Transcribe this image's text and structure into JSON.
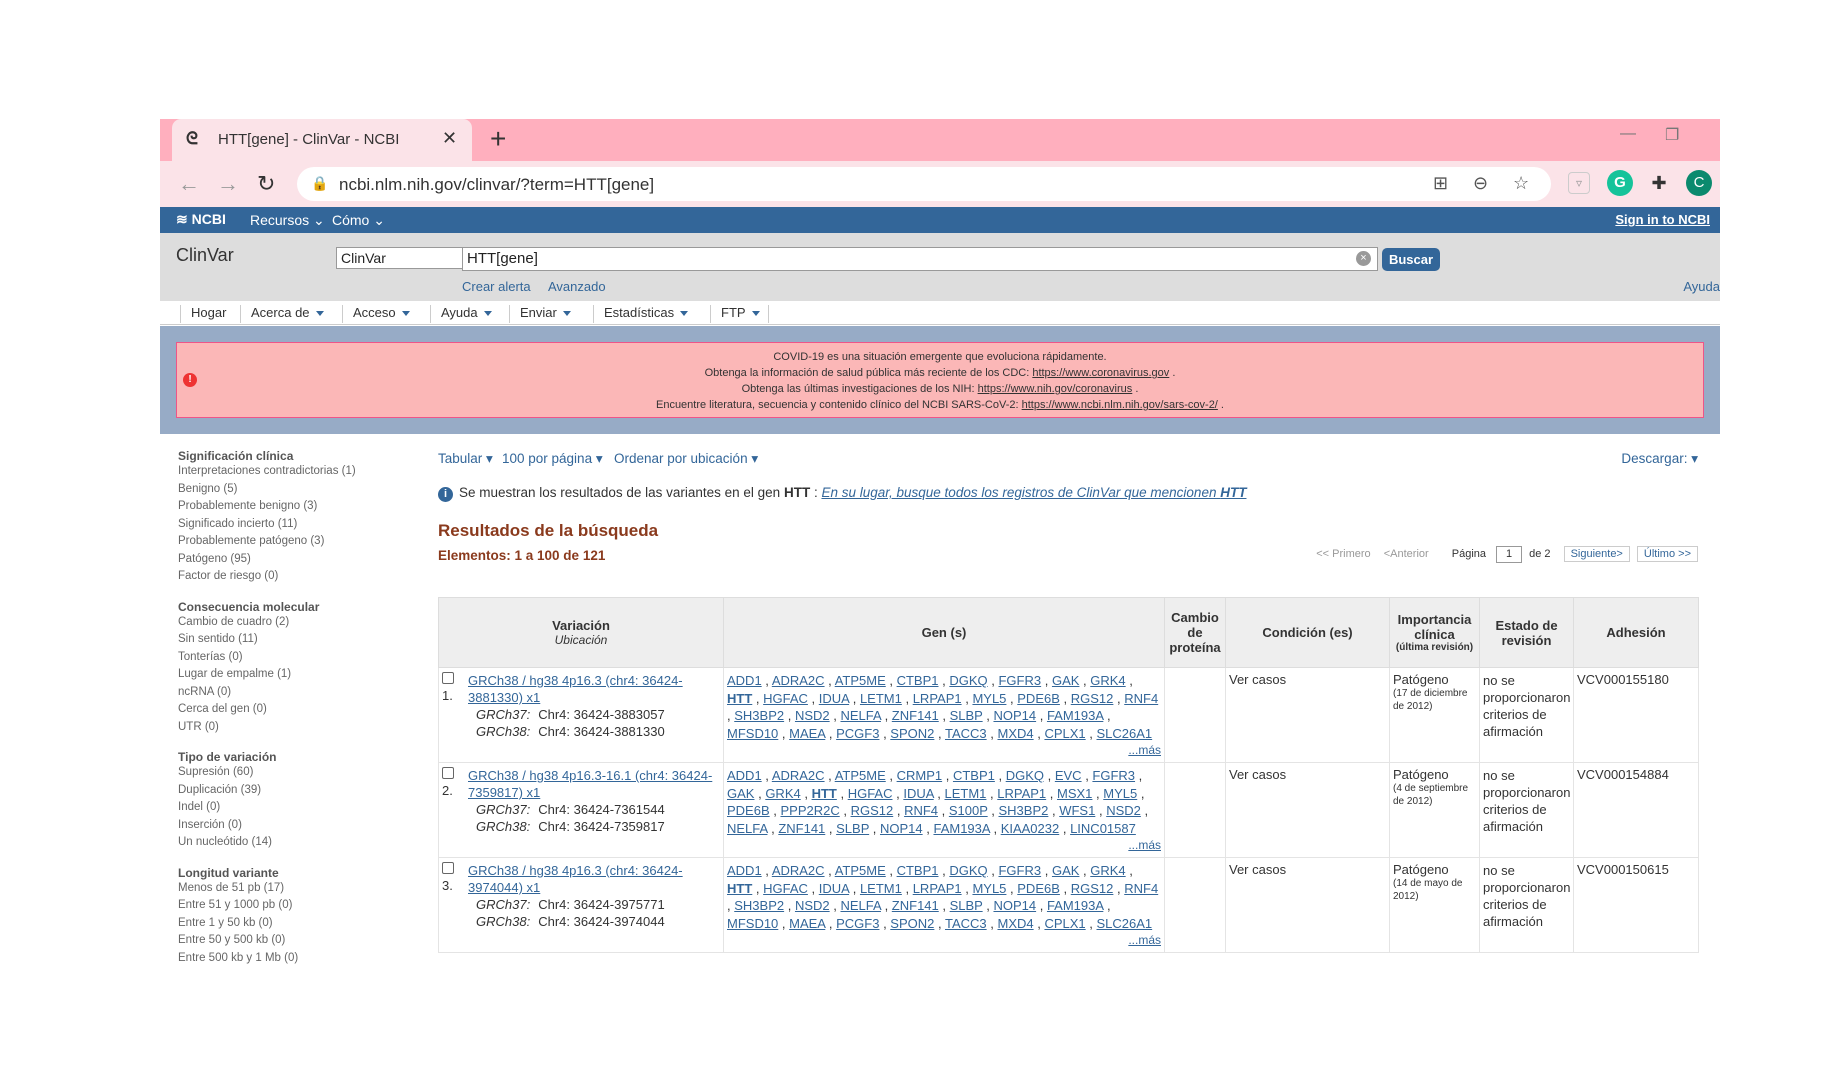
{
  "browser": {
    "tab_title": "HTT[gene] - ClinVar - NCBI",
    "url": "ncbi.nlm.nih.gov/clinvar/?term=HTT[gene]",
    "profile_initial": "C",
    "grammarly_initial": "G"
  },
  "ncbi": {
    "logo": "NCBI",
    "nav_recursos": "Recursos",
    "nav_como": "Cómo",
    "signin": "Sign in to NCBI"
  },
  "search": {
    "db_name": "ClinVar",
    "db_select": "ClinVar",
    "term": "HTT[gene]",
    "button": "Buscar",
    "crear_alerta": "Crear alerta",
    "avanzado": "Avanzado",
    "ayuda": "Ayuda"
  },
  "menu": {
    "items": [
      "Hogar",
      "Acerca de",
      "Acceso",
      "Ayuda",
      "Enviar",
      "Estadísticas",
      "FTP"
    ]
  },
  "banner": {
    "line1": "COVID-19 es una situación emergente que evoluciona rápidamente.",
    "line2_text": "Obtenga la información de salud pública más reciente de los CDC:",
    "line2_link": "https://www.coronavirus.gov",
    "line3_text": "Obtenga las últimas investigaciones de los NIH:",
    "line3_link": "https://www.nih.gov/coronavirus",
    "line4_text": "Encuentre literatura, secuencia y contenido clínico del NCBI SARS-CoV-2:",
    "line4_link": "https://www.ncbi.nlm.nih.gov/sars-cov-2/"
  },
  "facets": [
    {
      "title": "Significación clínica",
      "items": [
        "Interpretaciones contradictorias  (1)",
        "Benigno  (5)",
        "Probablemente benigno  (3)",
        "Significado incierto  (11)",
        "Probablemente patógeno  (3)",
        "Patógeno  (95)",
        "Factor de riesgo  (0)"
      ]
    },
    {
      "title": "Consecuencia molecular",
      "items": [
        "Cambio de cuadro  (2)",
        "Sin sentido  (11)",
        "Tonterías  (0)",
        "Lugar de empalme  (1)",
        "ncRNA  (0)",
        "Cerca del gen  (0)",
        "UTR  (0)"
      ]
    },
    {
      "title": "Tipo de variación",
      "items": [
        "Supresión  (60)",
        "Duplicación  (39)",
        "Indel  (0)",
        "Inserción  (0)",
        "Un nucleótido  (14)"
      ]
    },
    {
      "title": "Longitud variante",
      "items": [
        "Menos de 51 pb  (17)",
        "Entre 51 y 1000 pb  (0)",
        "Entre 1 y 50 kb  (0)",
        "Entre 50 y 500 kb  (0)",
        "Entre 500 kb y 1 Mb  (0)"
      ]
    }
  ],
  "controls": {
    "tabular": "Tabular",
    "per_page": "100 por página",
    "sort": "Ordenar por ubicación",
    "download": "Descargar:"
  },
  "info": {
    "text": "Se muestran los resultados de las variantes en el gen",
    "gene": "HTT",
    "link_text": "En su lugar, busque todos los registros de ClinVar que mencionen",
    "link_gene": "HTT"
  },
  "results": {
    "title": "Resultados de la búsqueda",
    "elements": "Elementos: 1 a 100 de 121"
  },
  "pager": {
    "first": "<< Primero",
    "prev": "<Anterior",
    "page_label": "Página",
    "page_value": "1",
    "of": "de 2",
    "next": "Siguiente>",
    "last": "Último >>"
  },
  "table": {
    "headers": {
      "variation": "Variación",
      "location": "Ubicación",
      "genes": "Gen (s)",
      "protein": "Cambio de proteína",
      "condition": "Condición (es)",
      "importance": "Importancia clínica",
      "importance_sub": "(última revisión)",
      "review": "Estado de revisión",
      "accession": "Adhesión"
    },
    "rows": [
      {
        "num": "1.",
        "variant": "GRCh38 / hg38 4p16.3 (chr4: 36424-3881330) x1",
        "grch37_label": "GRCh37:",
        "grch37": "Chr4: 36424-3883057",
        "grch38_label": "GRCh38:",
        "grch38": "Chr4: 36424-3881330",
        "genes": [
          "ADD1",
          "ADRA2C",
          "ATP5ME",
          "CTBP1",
          "DGKQ",
          "FGFR3",
          "GAK",
          "GRK4",
          "HTT",
          "HGFAC",
          "IDUA",
          "LETM1",
          "LRPAP1",
          "MYL5",
          "PDE6B",
          "RGS12",
          "RNF4",
          "SH3BP2",
          "NSD2",
          "NELFA",
          "ZNF141",
          "SLBP",
          "NOP14",
          "FAM193A",
          "MFSD10",
          "MAEA",
          "PCGF3",
          "SPON2",
          "TACC3",
          "MXD4",
          "CPLX1",
          "SLC26A1"
        ],
        "mas": "...más",
        "condition": "Ver casos",
        "significance": "Patógeno",
        "sig_date": "(17 de diciembre de 2012)",
        "review": "no se proporcionaron criterios de afirmación",
        "accession": "VCV000155180"
      },
      {
        "num": "2.",
        "variant": "GRCh38 / hg38 4p16.3-16.1 (chr4: 36424-7359817) x1",
        "grch37_label": "GRCh37:",
        "grch37": "Chr4: 36424-7361544",
        "grch38_label": "GRCh38:",
        "grch38": "Chr4: 36424-7359817",
        "genes": [
          "ADD1",
          "ADRA2C",
          "ATP5ME",
          "CRMP1",
          "CTBP1",
          "DGKQ",
          "EVC",
          "FGFR3",
          "GAK",
          "GRK4",
          "HTT",
          "HGFAC",
          "IDUA",
          "LETM1",
          "LRPAP1",
          "MSX1",
          "MYL5",
          "PDE6B",
          "PPP2R2C",
          "RGS12",
          "RNF4",
          "S100P",
          "SH3BP2",
          "WFS1",
          "NSD2",
          "NELFA",
          "ZNF141",
          "SLBP",
          "NOP14",
          "FAM193A",
          "KIAA0232",
          "LINC01587"
        ],
        "mas": "...más",
        "condition": "Ver casos",
        "significance": "Patógeno",
        "sig_date": "(4 de septiembre de 2012)",
        "review": "no se proporcionaron criterios de afirmación",
        "accession": "VCV000154884"
      },
      {
        "num": "3.",
        "variant": "GRCh38 / hg38 4p16.3 (chr4: 36424-3974044) x1",
        "grch37_label": "GRCh37:",
        "grch37": "Chr4: 36424-3975771",
        "grch38_label": "GRCh38:",
        "grch38": "Chr4: 36424-3974044",
        "genes": [
          "ADD1",
          "ADRA2C",
          "ATP5ME",
          "CTBP1",
          "DGKQ",
          "FGFR3",
          "GAK",
          "GRK4",
          "HTT",
          "HGFAC",
          "IDUA",
          "LETM1",
          "LRPAP1",
          "MYL5",
          "PDE6B",
          "RGS12",
          "RNF4",
          "SH3BP2",
          "NSD2",
          "NELFA",
          "ZNF141",
          "SLBP",
          "NOP14",
          "FAM193A",
          "MFSD10",
          "MAEA",
          "PCGF3",
          "SPON2",
          "TACC3",
          "MXD4",
          "CPLX1",
          "SLC26A1"
        ],
        "mas": "...más",
        "condition": "Ver casos",
        "significance": "Patógeno",
        "sig_date": "(14 de mayo de 2012)",
        "review": "no se proporcionaron criterios de afirmación",
        "accession": "VCV000150615"
      }
    ]
  },
  "colors": {
    "tab_bar": "#ffafbe",
    "ncbi_blue": "#336699",
    "banner_pink": "#fbb7b7",
    "results_brown": "#8a3a1d"
  }
}
